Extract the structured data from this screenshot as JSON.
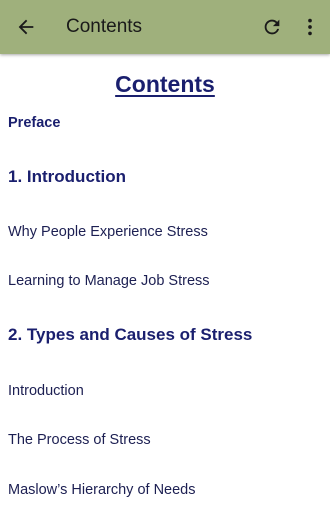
{
  "app_bar": {
    "title": "Contents",
    "back_icon": "arrow-left-icon",
    "refresh_icon": "refresh-icon",
    "more_icon": "more-vert-icon",
    "background_color": "#9fb07c"
  },
  "document": {
    "title": "Contents",
    "title_color": "#1a1f6e",
    "toc": [
      {
        "label": "Preface",
        "kind": "preface"
      },
      {
        "label": "1. Introduction",
        "kind": "chapter"
      },
      {
        "label": "Why People Experience Stress",
        "kind": "section"
      },
      {
        "label": "Learning to Manage Job Stress",
        "kind": "section"
      },
      {
        "label": "2. Types and Causes of Stress",
        "kind": "chapter"
      },
      {
        "label": "Introduction",
        "kind": "section"
      },
      {
        "label": "The Process of Stress",
        "kind": "section"
      },
      {
        "label": "Maslow’s Hierarchy of Needs",
        "kind": "section"
      }
    ]
  }
}
